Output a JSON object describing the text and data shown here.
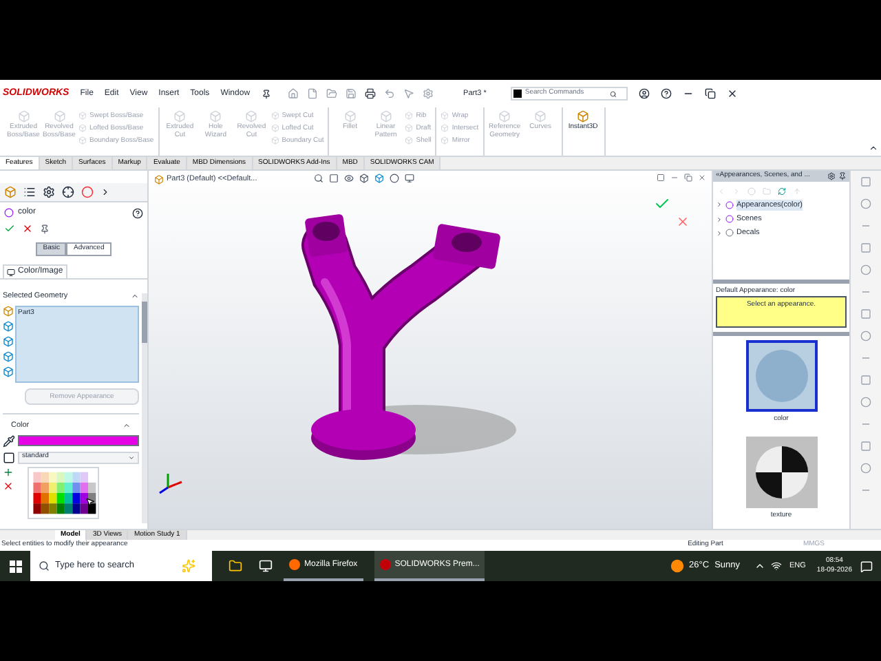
{
  "title_bar": {
    "logo": "SOLIDWORKS",
    "menus": [
      "File",
      "Edit",
      "View",
      "Insert",
      "Tools",
      "Window"
    ],
    "document": "Part3 *",
    "search": {
      "placeholder": "Search Commands"
    }
  },
  "ribbon": {
    "groups": [
      {
        "large": [
          {
            "label": "Extruded Boss/Base",
            "disabled": true
          },
          {
            "label": "Revolved Boss/Base",
            "disabled": true
          }
        ],
        "small": [
          {
            "label": "Swept Boss/Base",
            "disabled": true
          },
          {
            "label": "Lofted Boss/Base",
            "disabled": true
          },
          {
            "label": "Boundary Boss/Base",
            "disabled": true
          }
        ]
      },
      {
        "large": [
          {
            "label": "Extruded Cut",
            "disabled": true
          },
          {
            "label": "Hole Wizard",
            "disabled": true
          },
          {
            "label": "Revolved Cut",
            "disabled": true
          }
        ],
        "small": [
          {
            "label": "Swept Cut",
            "disabled": true
          },
          {
            "label": "Lofted Cut",
            "disabled": true
          },
          {
            "label": "Boundary Cut",
            "disabled": true
          }
        ]
      },
      {
        "large": [
          {
            "label": "Fillet",
            "disabled": true
          },
          {
            "label": "Linear Pattern",
            "disabled": true
          }
        ],
        "small": [
          {
            "label": "Rib",
            "disabled": true
          },
          {
            "label": "Draft",
            "disabled": true
          },
          {
            "label": "Shell",
            "disabled": true
          }
        ]
      },
      {
        "small": [
          {
            "label": "Wrap",
            "disabled": true
          },
          {
            "label": "Intersect",
            "disabled": true
          },
          {
            "label": "Mirror",
            "disabled": true
          }
        ]
      },
      {
        "large": [
          {
            "label": "Reference Geometry",
            "disabled": true
          },
          {
            "label": "Curves",
            "disabled": true
          }
        ]
      },
      {
        "large": [
          {
            "label": "Instant3D",
            "disabled": false
          }
        ]
      }
    ]
  },
  "command_tabs": [
    {
      "label": "Features",
      "selected": true
    },
    {
      "label": "Sketch",
      "selected": false
    },
    {
      "label": "Surfaces",
      "selected": false
    },
    {
      "label": "Markup",
      "selected": false
    },
    {
      "label": "Evaluate",
      "selected": false
    },
    {
      "label": "MBD Dimensions",
      "selected": false
    },
    {
      "label": "SOLIDWORKS Add-Ins",
      "selected": false
    },
    {
      "label": "MBD",
      "selected": false
    },
    {
      "label": "SOLIDWORKS CAM",
      "selected": false
    }
  ],
  "property_manager": {
    "title": "color",
    "modes": [
      {
        "label": "Basic",
        "selected": true
      },
      {
        "label": "Advanced",
        "selected": false
      }
    ],
    "tab": "Color/Image",
    "selected_geometry": {
      "heading": "Selected Geometry",
      "items": [
        "Part3"
      ]
    },
    "remove_button": "Remove Appearance",
    "color": {
      "heading": "Color",
      "palette": "standard"
    }
  },
  "viewport": {
    "tree_item": "Part3 (Default) <<Default..."
  },
  "bottom_tabs": [
    {
      "label": "Model",
      "selected": true
    },
    {
      "label": "3D Views",
      "selected": false
    },
    {
      "label": "Motion Study 1",
      "selected": false
    }
  ],
  "task_pane": {
    "title": "«Appearances, Scenes, and ...",
    "tree": [
      {
        "label": "Appearances(color)",
        "selected": true
      },
      {
        "label": "Scenes",
        "selected": false
      },
      {
        "label": "Decals",
        "selected": false
      }
    ],
    "default_label": "Default Appearance: color",
    "message": "Select an appearance.",
    "thumbnails": [
      {
        "label": "color",
        "selected": true
      },
      {
        "label": "texture",
        "selected": false
      }
    ]
  },
  "status_bar": {
    "message": "Select entities to modify their appearance",
    "mode": "Editing Part",
    "units": "MMGS"
  },
  "taskbar": {
    "search": {
      "placeholder": "Type here to search"
    },
    "apps": [
      "Mozilla Firefox",
      "SOLIDWORKS Prem..."
    ],
    "temperature": "26°C",
    "condition": "Sunny",
    "language": "ENG",
    "time": "08:54",
    "date": "18-09-2026"
  }
}
